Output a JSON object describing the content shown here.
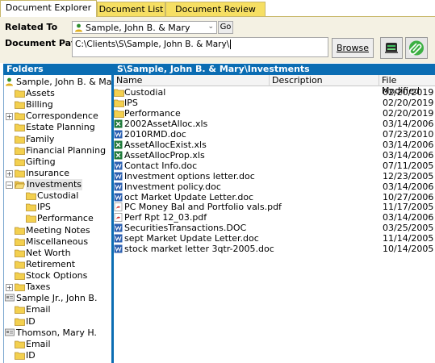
{
  "tabs": [
    {
      "label": "Document Explorer",
      "active": true
    },
    {
      "label": "Document List",
      "active": false
    },
    {
      "label": "Document Review",
      "active": false
    }
  ],
  "top": {
    "related_to_label": "Related To",
    "related_to_value": "Sample, John B. & Mary",
    "go_label": "Go",
    "doc_path_label": "Document Path",
    "doc_path_value": "C:\\Clients\\S\\Sample, John B. & Mary\\",
    "browse_label": "Browse"
  },
  "folders_header": "Folders",
  "path_header": "S\\Sample, John B. & Mary\\Investments",
  "tree": [
    {
      "label": "Sample, John B. & Mary",
      "level": 0,
      "icon": "person-icon",
      "expander": ""
    },
    {
      "label": "Assets",
      "level": 1,
      "icon": "folder-icon",
      "expander": ""
    },
    {
      "label": "Billing",
      "level": 1,
      "icon": "folder-icon",
      "expander": ""
    },
    {
      "label": "Correspondence",
      "level": 1,
      "icon": "folder-icon",
      "expander": "+"
    },
    {
      "label": "Estate Planning",
      "level": 1,
      "icon": "folder-icon",
      "expander": ""
    },
    {
      "label": "Family",
      "level": 1,
      "icon": "folder-icon",
      "expander": ""
    },
    {
      "label": "Financial Planning",
      "level": 1,
      "icon": "folder-icon",
      "expander": ""
    },
    {
      "label": "Gifting",
      "level": 1,
      "icon": "folder-icon",
      "expander": ""
    },
    {
      "label": "Insurance",
      "level": 1,
      "icon": "folder-icon",
      "expander": "+"
    },
    {
      "label": "Investments",
      "level": 1,
      "icon": "open-folder-icon",
      "expander": "-",
      "selected": true
    },
    {
      "label": "Custodial",
      "level": 2,
      "icon": "folder-icon",
      "expander": ""
    },
    {
      "label": "IPS",
      "level": 2,
      "icon": "folder-icon",
      "expander": ""
    },
    {
      "label": "Performance",
      "level": 2,
      "icon": "folder-icon",
      "expander": ""
    },
    {
      "label": "Meeting Notes",
      "level": 1,
      "icon": "folder-icon",
      "expander": ""
    },
    {
      "label": "Miscellaneous",
      "level": 1,
      "icon": "folder-icon",
      "expander": ""
    },
    {
      "label": "Net Worth",
      "level": 1,
      "icon": "folder-icon",
      "expander": ""
    },
    {
      "label": "Retirement",
      "level": 1,
      "icon": "folder-icon",
      "expander": ""
    },
    {
      "label": "Stock Options",
      "level": 1,
      "icon": "folder-icon",
      "expander": ""
    },
    {
      "label": "Taxes",
      "level": 1,
      "icon": "folder-icon",
      "expander": "+"
    },
    {
      "label": "Sample Jr., John B.",
      "level": 0,
      "icon": "card-icon",
      "expander": ""
    },
    {
      "label": "Email",
      "level": 1,
      "icon": "folder-icon",
      "expander": ""
    },
    {
      "label": "ID",
      "level": 1,
      "icon": "folder-icon",
      "expander": ""
    },
    {
      "label": "Thomson, Mary H.",
      "level": 0,
      "icon": "card-icon",
      "expander": ""
    },
    {
      "label": "Email",
      "level": 1,
      "icon": "folder-icon",
      "expander": ""
    },
    {
      "label": "ID",
      "level": 1,
      "icon": "folder-icon",
      "expander": ""
    }
  ],
  "columns": {
    "name": "Name",
    "description": "Description",
    "modified": "File Modified"
  },
  "files": [
    {
      "name": "Custodial",
      "date": "02/20/2019",
      "icon": "folder-icon"
    },
    {
      "name": "IPS",
      "date": "02/20/2019",
      "icon": "folder-icon"
    },
    {
      "name": "Performance",
      "date": "02/20/2019",
      "icon": "folder-icon"
    },
    {
      "name": "2002AssetAlloc.xls",
      "date": "03/14/2006",
      "icon": "excel-icon"
    },
    {
      "name": "2010RMD.doc",
      "date": "07/23/2010",
      "icon": "word-icon"
    },
    {
      "name": "AssetAllocExist.xls",
      "date": "03/14/2006",
      "icon": "excel-icon"
    },
    {
      "name": "AssetAllocProp.xls",
      "date": "03/14/2006",
      "icon": "excel-icon"
    },
    {
      "name": "Contact Info.doc",
      "date": "07/11/2005",
      "icon": "word-icon"
    },
    {
      "name": "Investment options letter.doc",
      "date": "12/23/2005",
      "icon": "word-icon"
    },
    {
      "name": "Investment policy.doc",
      "date": "03/14/2006",
      "icon": "word-icon"
    },
    {
      "name": "oct Market Update Letter.doc",
      "date": "10/27/2006",
      "icon": "word-icon"
    },
    {
      "name": "PC Money Bal and Portfolio vals.pdf",
      "date": "11/17/2005",
      "icon": "pdf-icon"
    },
    {
      "name": "Perf  Rpt 12_03.pdf",
      "date": "03/14/2006",
      "icon": "pdf-icon"
    },
    {
      "name": "SecuritiesTransactions.DOC",
      "date": "03/25/2005",
      "icon": "word-icon"
    },
    {
      "name": "sept Market Update Letter.doc",
      "date": "11/14/2005",
      "icon": "word-icon"
    },
    {
      "name": "stock market letter 3qtr-2005.doc",
      "date": "10/14/2005",
      "icon": "word-icon"
    }
  ],
  "colors": {
    "header_blue": "#0b6db3",
    "tab_yellow": "#f6df63",
    "folder_yellow": "#f3d04f",
    "panel_bg": "#f4f1e3"
  }
}
